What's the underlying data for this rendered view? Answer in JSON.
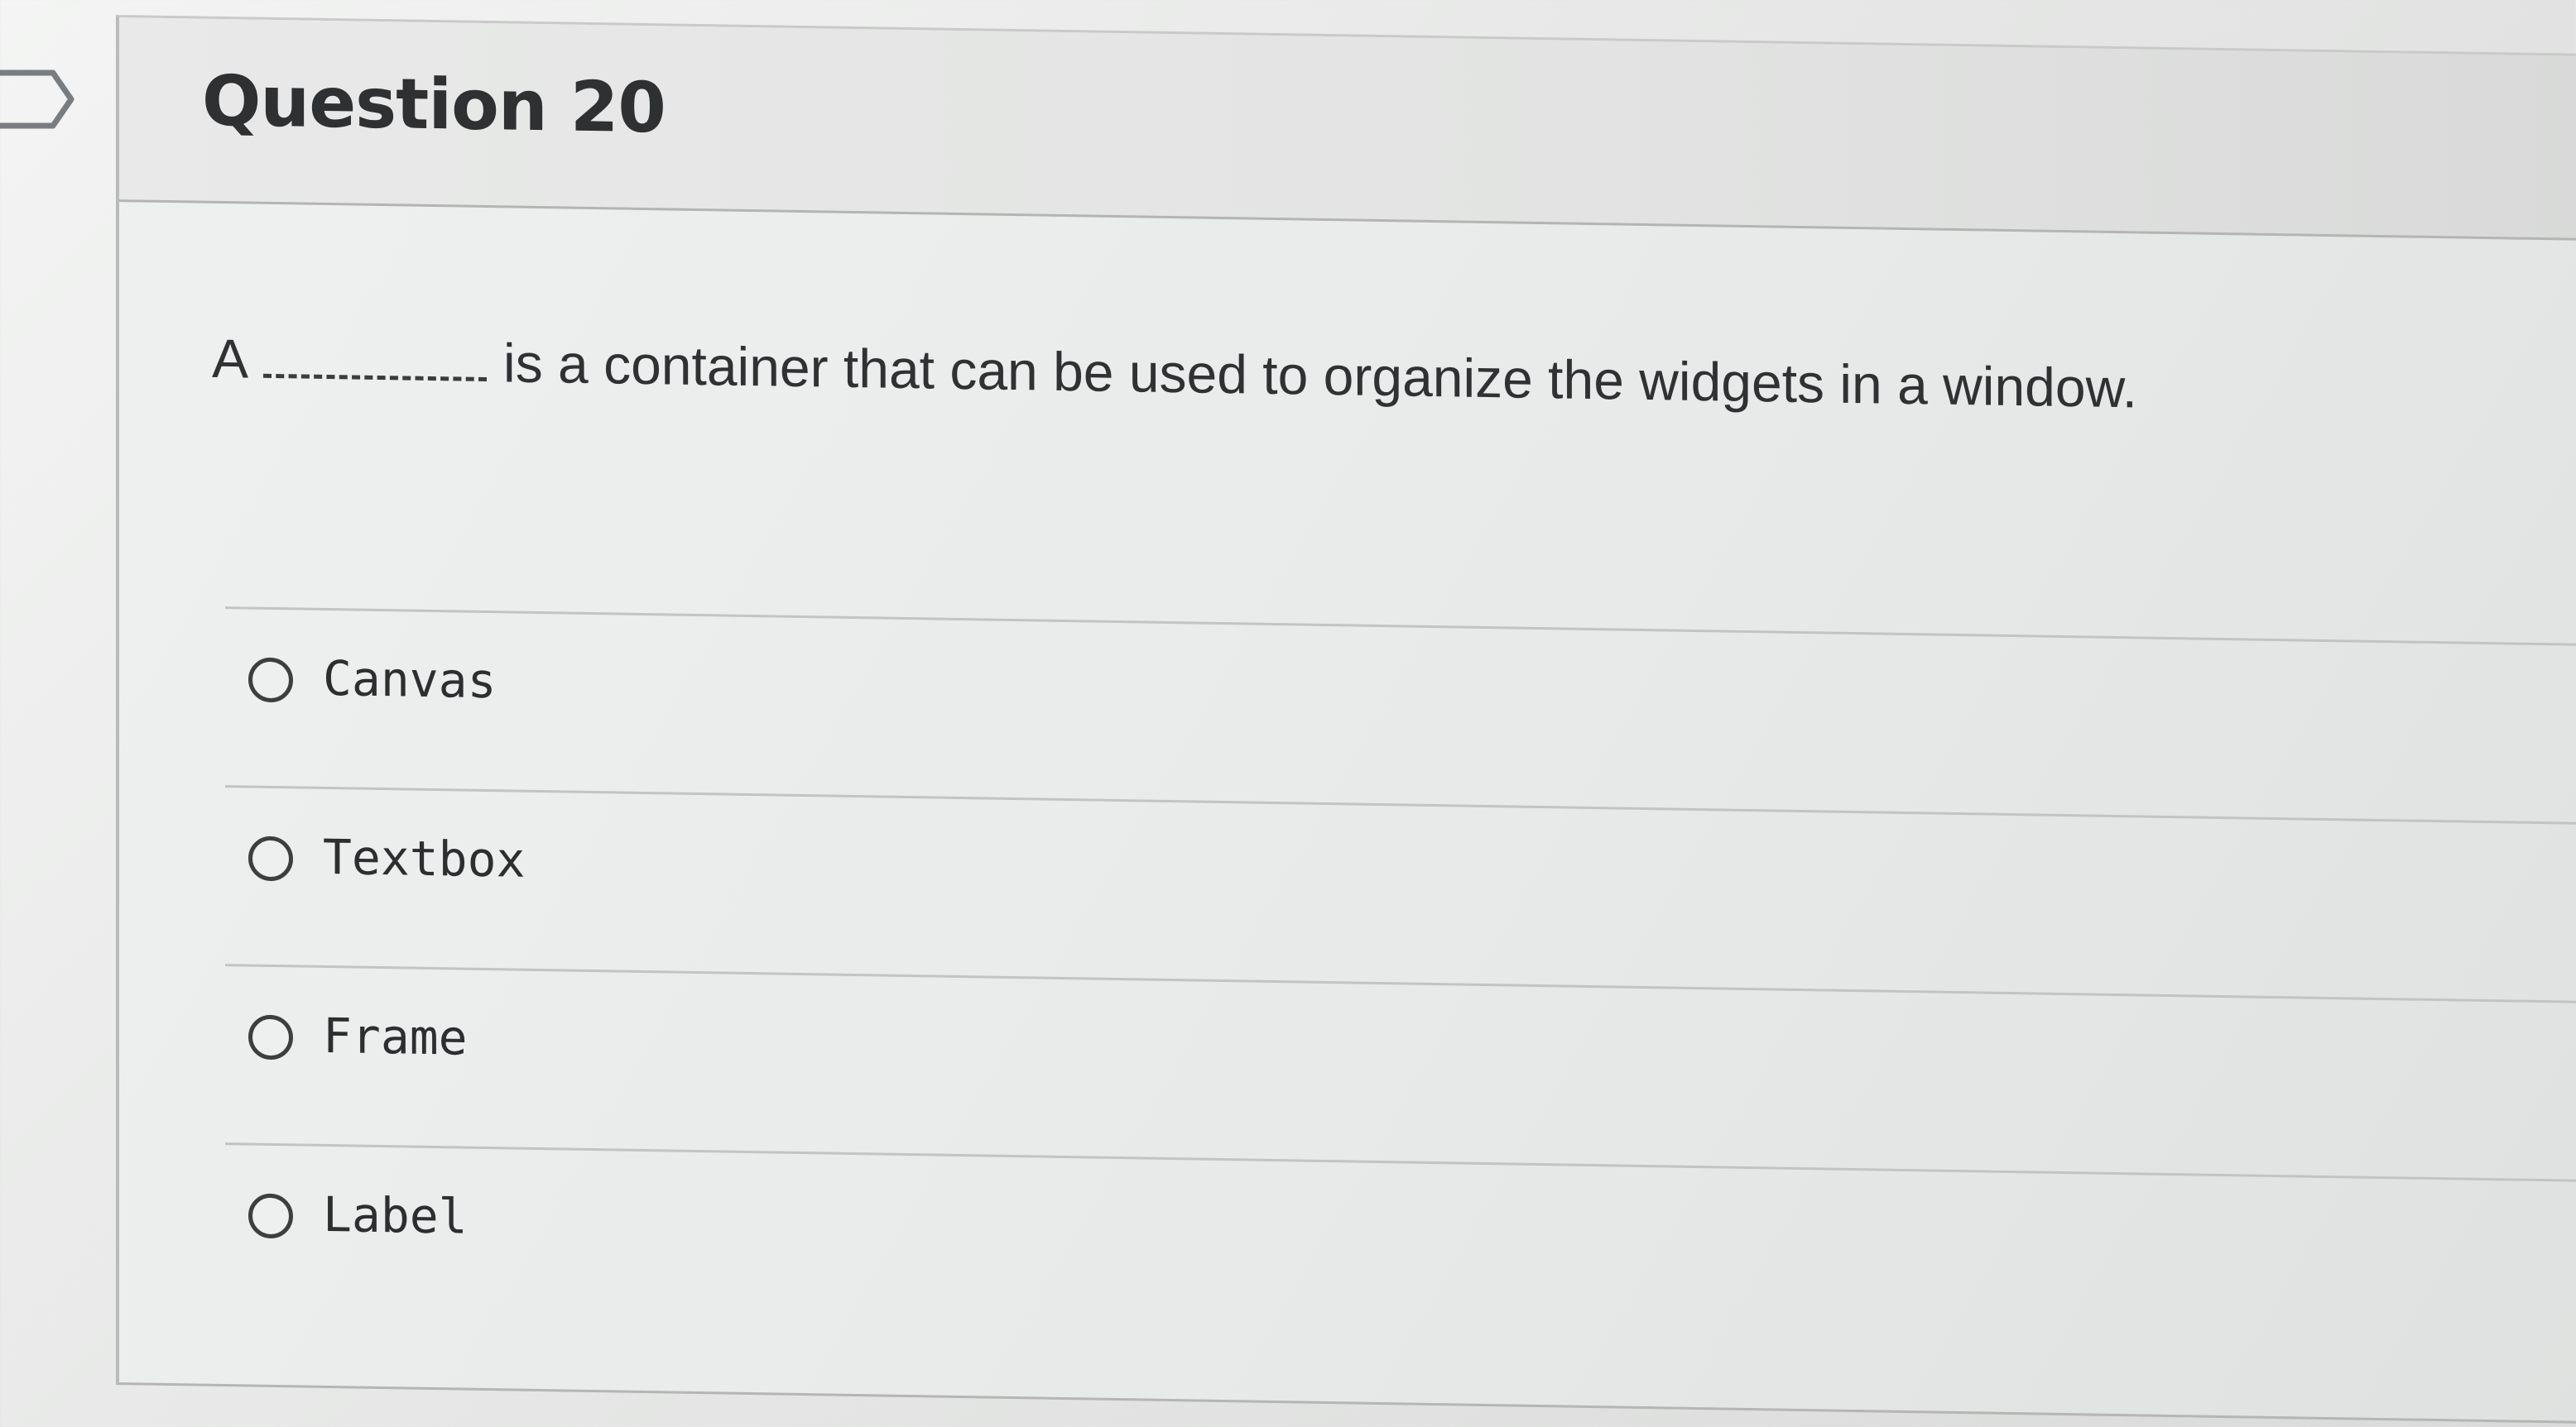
{
  "question": {
    "title": "Question 20",
    "text_before_blank": "A",
    "text_after_blank": "is a container that can be used to organize the widgets in a window.",
    "answers": [
      {
        "label": "Canvas"
      },
      {
        "label": "Textbox"
      },
      {
        "label": "Frame"
      },
      {
        "label": "Label"
      }
    ]
  },
  "icons": {
    "flag": "bookmark-flag-icon",
    "radio": "radio-circle-icon"
  },
  "colors": {
    "text": "#2e3032",
    "border": "#b4b6b4",
    "background": "#e8eaea"
  }
}
